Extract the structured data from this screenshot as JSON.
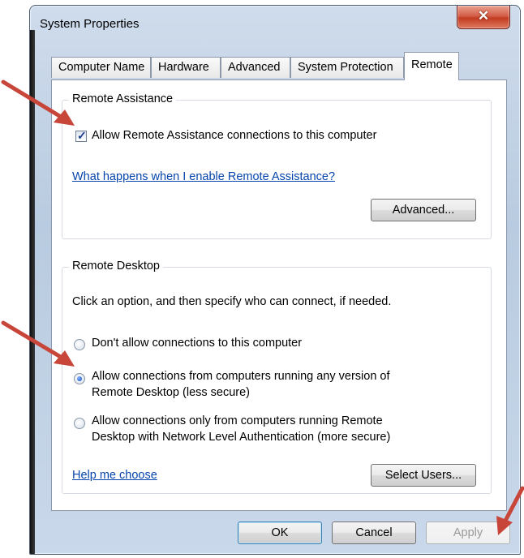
{
  "window": {
    "title": "System Properties"
  },
  "tabs": [
    {
      "label": "Computer Name",
      "active": false
    },
    {
      "label": "Hardware",
      "active": false
    },
    {
      "label": "Advanced",
      "active": false
    },
    {
      "label": "System Protection",
      "active": false
    },
    {
      "label": "Remote",
      "active": true
    }
  ],
  "remote_assistance": {
    "group_label": "Remote Assistance",
    "checkbox_label": "Allow Remote Assistance connections to this computer",
    "checkbox_checked": true,
    "help_link": "What happens when I enable Remote Assistance?",
    "advanced_button": "Advanced..."
  },
  "remote_desktop": {
    "group_label": "Remote Desktop",
    "instruction": "Click an option, and then specify who can connect, if needed.",
    "options": [
      {
        "line1": "Don't allow connections to this computer",
        "line2": "",
        "selected": false
      },
      {
        "line1": "Allow connections from computers running any version of",
        "line2": "Remote Desktop (less secure)",
        "selected": true
      },
      {
        "line1": "Allow connections only from computers running Remote",
        "line2": "Desktop with Network Level Authentication (more secure)",
        "selected": false
      }
    ],
    "help_link": "Help me choose",
    "select_users_button": "Select Users..."
  },
  "footer": {
    "ok": "OK",
    "cancel": "Cancel",
    "apply": "Apply"
  },
  "colors": {
    "annotation_arrow": "#c8453a",
    "link": "#0645ad"
  },
  "icons": {
    "close": "close-icon",
    "check": "check-icon",
    "arrow": "annotation-arrow-icon"
  }
}
